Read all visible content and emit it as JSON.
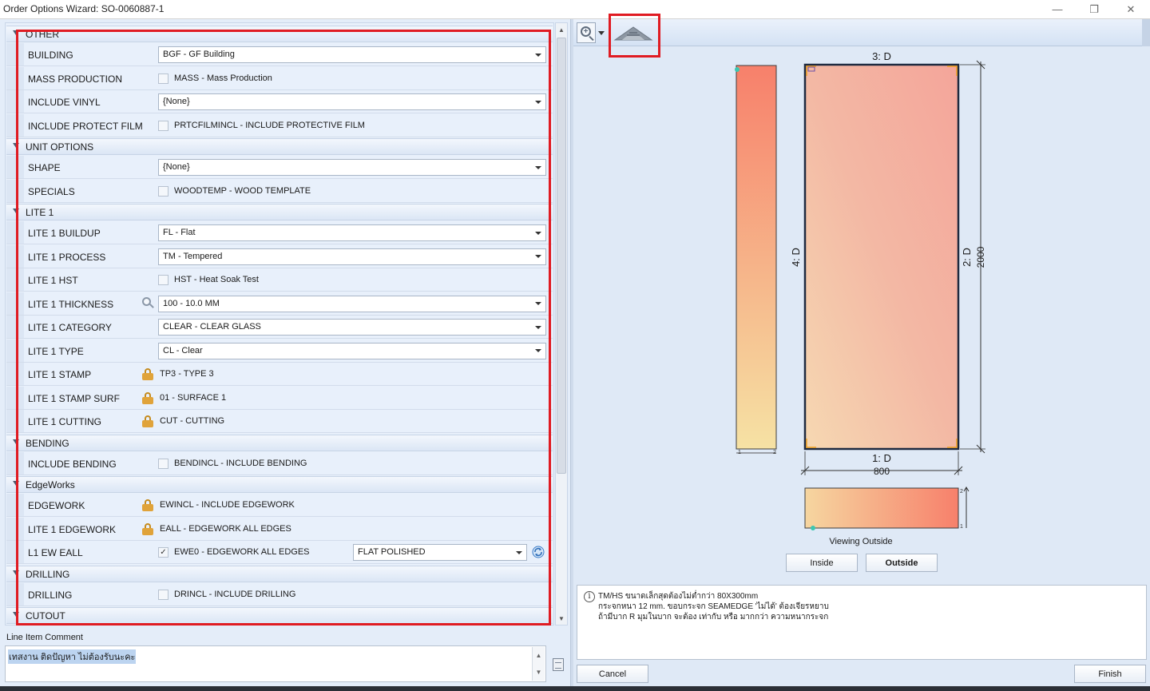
{
  "window": {
    "title": "Order Options Wizard: SO-0060887-1"
  },
  "sections": [
    {
      "title": "OTHER",
      "rows": [
        {
          "label": "BUILDING",
          "type": "combo",
          "value": "BGF - GF Building"
        },
        {
          "label": "MASS PRODUCTION",
          "type": "check",
          "checked": false,
          "value": "MASS - Mass Production"
        },
        {
          "label": "INCLUDE VINYL",
          "type": "combo",
          "value": "{None}"
        },
        {
          "label": "INCLUDE PROTECT FILM",
          "type": "check",
          "checked": false,
          "value": "PRTCFILMINCL - INCLUDE PROTECTIVE FILM"
        }
      ]
    },
    {
      "title": "UNIT OPTIONS",
      "rows": [
        {
          "label": "SHAPE",
          "type": "combo",
          "value": "{None}"
        },
        {
          "label": "SPECIALS",
          "type": "check",
          "checked": false,
          "value": "WOODTEMP - WOOD TEMPLATE"
        }
      ]
    },
    {
      "title": "LITE 1",
      "rows": [
        {
          "label": "LITE 1 BUILDUP",
          "type": "combo",
          "value": "FL - Flat"
        },
        {
          "label": "LITE 1 PROCESS",
          "type": "combo",
          "value": "TM - Tempered"
        },
        {
          "label": "LITE 1 HST",
          "type": "check",
          "checked": false,
          "value": "HST - Heat Soak Test"
        },
        {
          "label": "LITE 1 THICKNESS",
          "type": "combo",
          "search": true,
          "value": "100 - 10.0 MM"
        },
        {
          "label": "LITE 1 CATEGORY",
          "type": "combo",
          "value": "CLEAR - CLEAR GLASS"
        },
        {
          "label": "LITE 1 TYPE",
          "type": "combo",
          "value": "CL - Clear"
        },
        {
          "label": "LITE 1 STAMP",
          "type": "locked",
          "value": "TP3 - TYPE 3"
        },
        {
          "label": "LITE 1 STAMP SURF",
          "type": "locked",
          "value": "01 - SURFACE 1"
        },
        {
          "label": "LITE 1 CUTTING",
          "type": "locked",
          "value": "CUT - CUTTING"
        }
      ]
    },
    {
      "title": "BENDING",
      "rows": [
        {
          "label": "INCLUDE BENDING",
          "type": "check",
          "checked": false,
          "value": "BENDINCL - INCLUDE BENDING"
        }
      ]
    },
    {
      "title": "EdgeWorks",
      "rows": [
        {
          "label": "EDGEWORK",
          "type": "locked",
          "value": "EWINCL - INCLUDE EDGEWORK"
        },
        {
          "label": "LITE 1 EDGEWORK",
          "type": "locked",
          "value": "EALL - EDGEWORK ALL EDGES"
        },
        {
          "label": "L1 EW EALL",
          "type": "check-combo",
          "checked": true,
          "value": "EWE0 - EDGEWORK ALL EDGES",
          "combo_value": "FLAT POLISHED"
        }
      ]
    },
    {
      "title": "DRILLING",
      "rows": [
        {
          "label": "DRILLING",
          "type": "check",
          "checked": false,
          "value": "DRINCL - INCLUDE DRILLING"
        }
      ]
    },
    {
      "title": "CUTOUT",
      "rows": []
    }
  ],
  "comment": {
    "label": "Line Item Comment",
    "value": "เทสงาน ติดปัญหา ไม่ต้องรับนะคะ"
  },
  "drawing": {
    "top_label": "3: D",
    "left_label": "4: D",
    "right_label": "2: D",
    "height_dim": "2000",
    "bottom_label": "1: D",
    "width_dim": "800",
    "side_tick_1": "1",
    "side_tick_2": "2",
    "bottom_tick_1": "1",
    "bottom_tick_2": "2",
    "viewing_text": "Viewing Outside",
    "glass_color_a": "#f7806b",
    "glass_color_b": "#f6e2a4",
    "corner_color": "#f0a020"
  },
  "view_buttons": {
    "inside": "Inside",
    "outside": "Outside"
  },
  "info": {
    "lines": [
      "TM/HS ขนาดเล็กสุดต้องไม่ต่ำกว่า 80X300mm",
      "กระจกหนา 12 mm. ขอบกระจก SEAMEDGE 'ไม่ได้' ต้องเจียรหยาบ",
      "ถ้ามีบาก R มุมในบาก จะต้อง เท่ากับ หรือ มากกว่า ความหนากระจก"
    ]
  },
  "footer": {
    "cancel": "Cancel",
    "finish": "Finish"
  },
  "colors": {
    "highlight_border": "#e01b22",
    "panel_bg": "#e8f0fb"
  }
}
